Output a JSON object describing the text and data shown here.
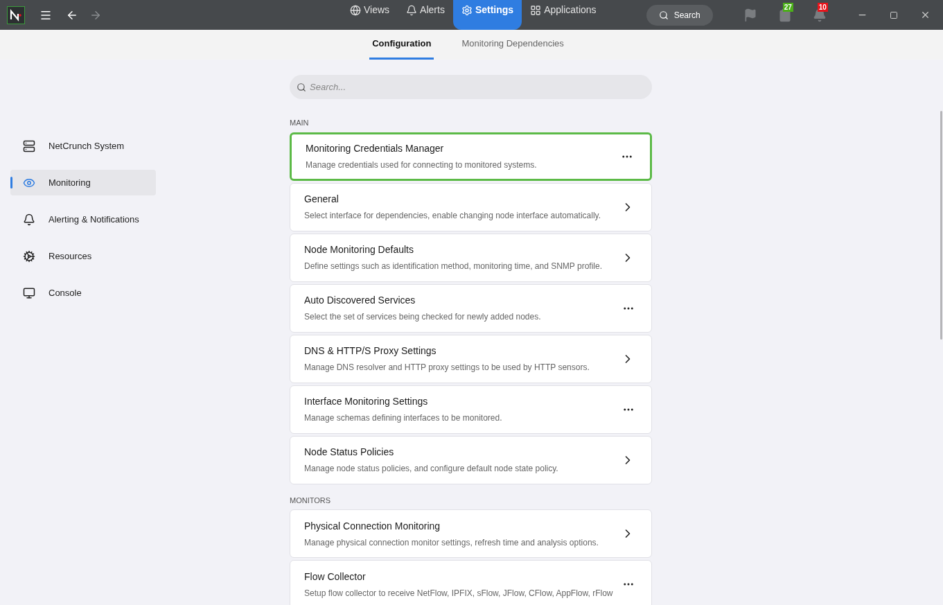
{
  "topbar": {
    "nav": [
      {
        "label": "Views",
        "selected": false
      },
      {
        "label": "Alerts",
        "selected": false
      },
      {
        "label": "Settings",
        "selected": true
      },
      {
        "label": "Applications",
        "selected": false
      }
    ],
    "search": "Search",
    "badges": [
      {
        "count": "27",
        "color": "#4caf1a"
      },
      {
        "count": "10",
        "color": "#e8141b"
      }
    ]
  },
  "subtabs": [
    {
      "label": "Configuration",
      "selected": true
    },
    {
      "label": "Monitoring Dependencies",
      "selected": false
    }
  ],
  "search": {
    "placeholder": "Search..."
  },
  "sidebar": {
    "items": [
      {
        "label": "NetCrunch System",
        "selected": false
      },
      {
        "label": "Monitoring",
        "selected": true
      },
      {
        "label": "Alerting & Notifications",
        "selected": false
      },
      {
        "label": "Resources",
        "selected": false
      },
      {
        "label": "Console",
        "selected": false
      }
    ]
  },
  "sections": [
    {
      "title": "MAIN",
      "items": [
        {
          "title": "Monitoring Credentials Manager",
          "description": "Manage credentials used for connecting to monitored systems.",
          "kind": "menu",
          "selected": true
        },
        {
          "title": "General",
          "description": "Select interface for dependencies, enable changing node interface automatically.",
          "kind": "chevron",
          "selected": false
        },
        {
          "title": "Node Monitoring Defaults",
          "description": "Define settings such as identification method, monitoring time, and SNMP profile.",
          "kind": "chevron",
          "selected": false
        },
        {
          "title": "Auto Discovered Services",
          "description": "Select the set of services being checked for newly added nodes.",
          "kind": "menu",
          "selected": false
        },
        {
          "title": "DNS & HTTP/S Proxy Settings",
          "description": "Manage DNS resolver and HTTP proxy settings to be used by HTTP sensors.",
          "kind": "chevron",
          "selected": false
        },
        {
          "title": "Interface Monitoring Settings",
          "description": "Manage schemas defining interfaces to be monitored.",
          "kind": "menu",
          "selected": false
        },
        {
          "title": "Node Status Policies",
          "description": "Manage node status policies, and configure default node state policy.",
          "kind": "chevron",
          "selected": false
        }
      ]
    },
    {
      "title": "MONITORS",
      "items": [
        {
          "title": "Physical Connection Monitoring",
          "description": "Manage physical connection monitor settings, refresh time and analysis options.",
          "kind": "chevron",
          "selected": false
        },
        {
          "title": "Flow Collector",
          "description": "Setup flow collector to receive NetFlow, IPFIX, sFlow, JFlow, CFlow, AppFlow, rFlow",
          "kind": "menu",
          "selected": false
        }
      ]
    }
  ]
}
